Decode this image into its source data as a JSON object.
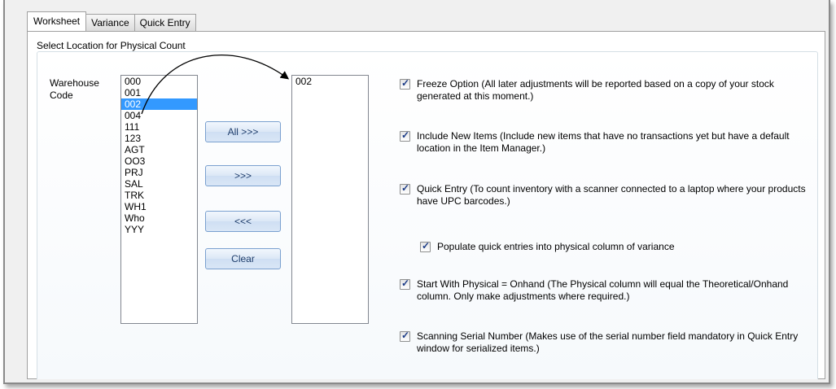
{
  "tabs": [
    {
      "label": "Worksheet",
      "active": true
    },
    {
      "label": "Variance",
      "active": false
    },
    {
      "label": "Quick Entry",
      "active": false
    }
  ],
  "group_title": "Select Location for Physical Count",
  "warehouse_label": "Warehouse Code",
  "source_list": {
    "items": [
      "000",
      "001",
      "002",
      "004",
      "111",
      "123",
      "AGT",
      "OO3",
      "PRJ",
      "SAL",
      "TRK",
      "WH1",
      "Who",
      "YYY"
    ],
    "selected": "002"
  },
  "destination_list": {
    "items": [
      "002"
    ]
  },
  "buttons": {
    "all": "All >>>",
    "add": ">>>",
    "remove": "<<<",
    "clear": "Clear"
  },
  "options": [
    {
      "checked": true,
      "text": "Freeze Option (All later adjustments will be reported based on a copy of your stock generated at this moment.)"
    },
    {
      "checked": true,
      "text": "Include New Items (Include new items that have no transactions yet but have a default location in the Item Manager.)"
    },
    {
      "checked": true,
      "text": "Quick Entry (To count inventory with a scanner connected to a laptop where your products have UPC barcodes.)"
    },
    {
      "checked": true,
      "text": "Populate quick entries into physical column of variance"
    },
    {
      "checked": true,
      "text": "Start With Physical = Onhand (The Physical column will equal the Theoretical/Onhand column.  Only make adjustments where required.)"
    },
    {
      "checked": true,
      "text": "Scanning Serial Number (Makes use of the serial number field mandatory in Quick Entry window for serialized items.)"
    }
  ],
  "colors": {
    "selection": "#3399ff",
    "button_text": "#1e3d6b",
    "check": "#1c3c87"
  }
}
